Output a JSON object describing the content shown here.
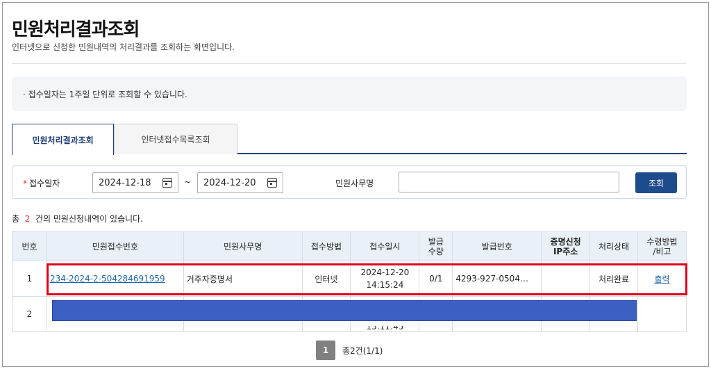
{
  "page": {
    "title": "민원처리결과조회",
    "description": "인터넷으로 신청한 민원내역의 처리결과를 조회하는 화면입니다."
  },
  "notice": "· 접수일자는 1주일 단위로 조회할 수 있습니다.",
  "tabs": [
    {
      "label": "민원처리결과조회",
      "active": true
    },
    {
      "label": "인터넷접수목록조회",
      "active": false
    }
  ],
  "search": {
    "date_label": "접수일자",
    "required_mark": "*",
    "date_from": "2024-12-18",
    "separator": "~",
    "date_to": "2024-12-20",
    "office_label": "민원사무명",
    "office_value": "",
    "button_label": "조회"
  },
  "summary": {
    "prefix": "총",
    "count": "2",
    "suffix": "건의 민원신청내역이 있습니다."
  },
  "table": {
    "headers": [
      "번호",
      "민원접수번호",
      "민원사무명",
      "접수방법",
      "접수일시",
      "발급\n수량",
      "발급번호",
      "증명신청\nIP주소",
      "처리상태",
      "수령방법\n/비고"
    ],
    "rows": [
      {
        "no": "1",
        "receipt_no": "234-2024-2-504284691959",
        "office": "거주자증명서",
        "method": "인터넷",
        "date": "2024-12-20",
        "time": "14:15:24",
        "qty": "0/1",
        "issue_no": "4293-927-0504…",
        "ip": "",
        "status": "처리완료",
        "receive": "출력"
      },
      {
        "no": "2",
        "time_partial": "15:11:45"
      }
    ]
  },
  "pager": {
    "current": "1",
    "total_label": "총2건(1/1)"
  },
  "colors": {
    "primary": "#1e4b8c",
    "highlight": "#e0001a",
    "redaction": "#3c5fc4",
    "header_bg": "#e9f0f7"
  }
}
